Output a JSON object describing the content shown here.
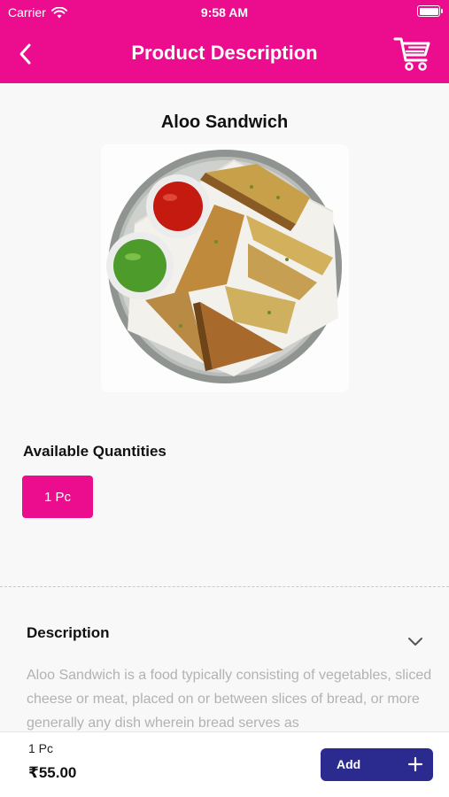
{
  "status_bar": {
    "carrier": "Carrier",
    "time": "9:58 AM",
    "icons": [
      "wifi-icon",
      "battery-icon"
    ]
  },
  "header": {
    "title": "Product Description",
    "back_icon": "chevron-left-icon",
    "cart_icon": "cart-icon"
  },
  "product": {
    "name": "Aloo Sandwich",
    "image": "aloo-sandwich-plate-photo"
  },
  "quantities": {
    "title": "Available Quantities",
    "options": [
      "1 Pc"
    ],
    "selected": "1 Pc"
  },
  "description": {
    "title": "Description",
    "text": "Aloo Sandwich is a food typically consisting of vegetables, sliced cheese or meat, placed on or between slices of bread, or more generally any dish wherein bread serves as",
    "toggle_icon": "chevron-down-icon"
  },
  "footer": {
    "selected_qty": "1 Pc",
    "price": "₹55.00",
    "add_label": "Add",
    "add_icon": "plus-icon"
  },
  "colors": {
    "primary": "#ec0c8e",
    "add_button": "#2a2a8f",
    "background": "#f8f8f8"
  }
}
